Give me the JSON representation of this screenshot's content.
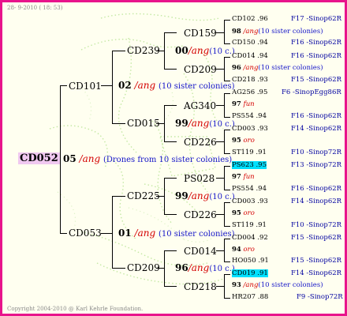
{
  "header": {
    "date": "28- 9-2010 ( 18: 53)"
  },
  "footer": {
    "copyright": "Copyright 2004-2010 @ Karl Kehrle Foundation."
  },
  "root": {
    "name": "CD052"
  },
  "gen1": {
    "sire": "CD101",
    "dam": "CD053",
    "bee": {
      "num": "05",
      "lang": "/ang",
      "desc": "(Drones from 10 sister colonies)"
    }
  },
  "gen2": {
    "n1": "CD239",
    "n2": "CD015",
    "n3": "CD225",
    "n4": "CD209",
    "b_upper": {
      "num": "02",
      "lang": "/ang",
      "desc": "(10 sister colonies)"
    },
    "b_lower": {
      "num": "01",
      "lang": "/ang",
      "desc": "(10 sister colonies)"
    }
  },
  "gen3": {
    "n1": "CD159",
    "n2": "CD209",
    "n3": "AG340",
    "n4": "CD226",
    "n5": "PS028",
    "n6": "CD226",
    "n7": "CD014",
    "n8": "CD218",
    "b1": {
      "num": "00",
      "lang": "/ang",
      "desc": "(10 c.)"
    },
    "b2": {
      "num": "99",
      "lang": "/ang",
      "desc": "(10 c.)"
    },
    "b3": {
      "num": "99",
      "lang": "/ang",
      "desc": "(10 c.)"
    },
    "b4": {
      "num": "96",
      "lang": "/ang",
      "desc": "(10 c.)"
    }
  },
  "gen4": [
    {
      "name": "CD102",
      "yr": ".96",
      "ident": "F17 -Sinop62R"
    },
    {
      "num": "98",
      "lang": "/ang",
      "desc": "(10 sister colonies)"
    },
    {
      "name": "CD150",
      "yr": ".94",
      "ident": "F16 -Sinop62R"
    },
    {
      "name": "CD014",
      "yr": ".94",
      "ident": "F16 -Sinop62R"
    },
    {
      "num": "96",
      "lang": "/ang",
      "desc": "(10 sister colonies)"
    },
    {
      "name": "CD218",
      "yr": ".93",
      "ident": "F15 -Sinop62R"
    },
    {
      "name": "AG256",
      "yr": ".95",
      "ident": "F6 -SinopEgg86R"
    },
    {
      "num": "97",
      "lang": "fun",
      "desc": ""
    },
    {
      "name": "PS554",
      "yr": ".94",
      "ident": "F16 -Sinop62R"
    },
    {
      "name": "CD003",
      "yr": ".93",
      "ident": "F14 -Sinop62R"
    },
    {
      "num": "95",
      "lang": "oro",
      "desc": ""
    },
    {
      "name": "ST119",
      "yr": ".91",
      "ident": "F10 -Sinop72R"
    },
    {
      "name": "PS623",
      "yr": ".95",
      "ident": "F13 -Sinop72R"
    },
    {
      "num": "97",
      "lang": "fun",
      "desc": ""
    },
    {
      "name": "PS554",
      "yr": ".94",
      "ident": "F16 -Sinop62R"
    },
    {
      "name": "CD003",
      "yr": ".93",
      "ident": "F14 -Sinop62R"
    },
    {
      "num": "95",
      "lang": "oro",
      "desc": ""
    },
    {
      "name": "ST119",
      "yr": ".91",
      "ident": "F10 -Sinop72R"
    },
    {
      "name": "CD004",
      "yr": ".92",
      "ident": "F15 -Sinop62R"
    },
    {
      "num": "94",
      "lang": "oro",
      "desc": ""
    },
    {
      "name": "HO050",
      "yr": ".91",
      "ident": "F15 -Sinop62R"
    },
    {
      "name": "CD019",
      "yr": ".91",
      "ident": "F14 -Sinop62R"
    },
    {
      "num": "93",
      "lang": "/ang",
      "desc": "(10 sister colonies)"
    },
    {
      "name": "HR207",
      "yr": ".88",
      "ident": "F9 -Sinop72R"
    }
  ],
  "colors": {
    "frame": "#e8148c",
    "background": "#fffff0",
    "highlight": "#00e0ff",
    "root_bg": "#f0c8f0",
    "lang": "#d40000",
    "ident": "#0000a0"
  }
}
